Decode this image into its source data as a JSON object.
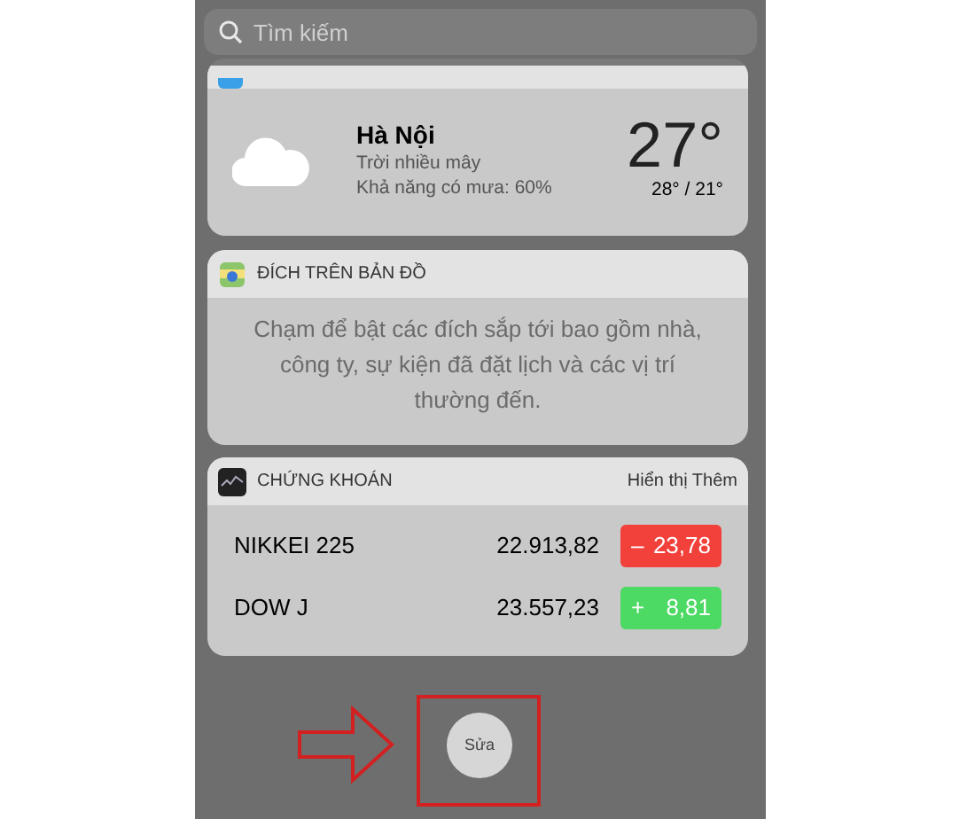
{
  "search": {
    "placeholder": "Tìm kiếm"
  },
  "weather": {
    "city": "Hà Nội",
    "condition": "Trời nhiều mây",
    "rain_chance": "Khả năng có mưa: 60%",
    "temperature": "27°",
    "high_low": "28° / 21°"
  },
  "maps_widget": {
    "title": "ĐÍCH TRÊN BẢN ĐỒ",
    "message": "Chạm để bật các đích sắp tới bao gồm nhà, công ty, sự kiện đã đặt lịch và các vị trí thường đến."
  },
  "stocks_widget": {
    "title": "CHỨNG KHOÁN",
    "show_more": "Hiển thị Thêm",
    "rows": [
      {
        "name": "NIKKEI 225",
        "price": "22.913,82",
        "sign": "–",
        "change": "23,78",
        "color": "#f2403a"
      },
      {
        "name": "DOW J",
        "price": "23.557,23",
        "sign": "+",
        "change": "8,81",
        "color": "#4cd964"
      }
    ]
  },
  "edit_button": "Sửa"
}
